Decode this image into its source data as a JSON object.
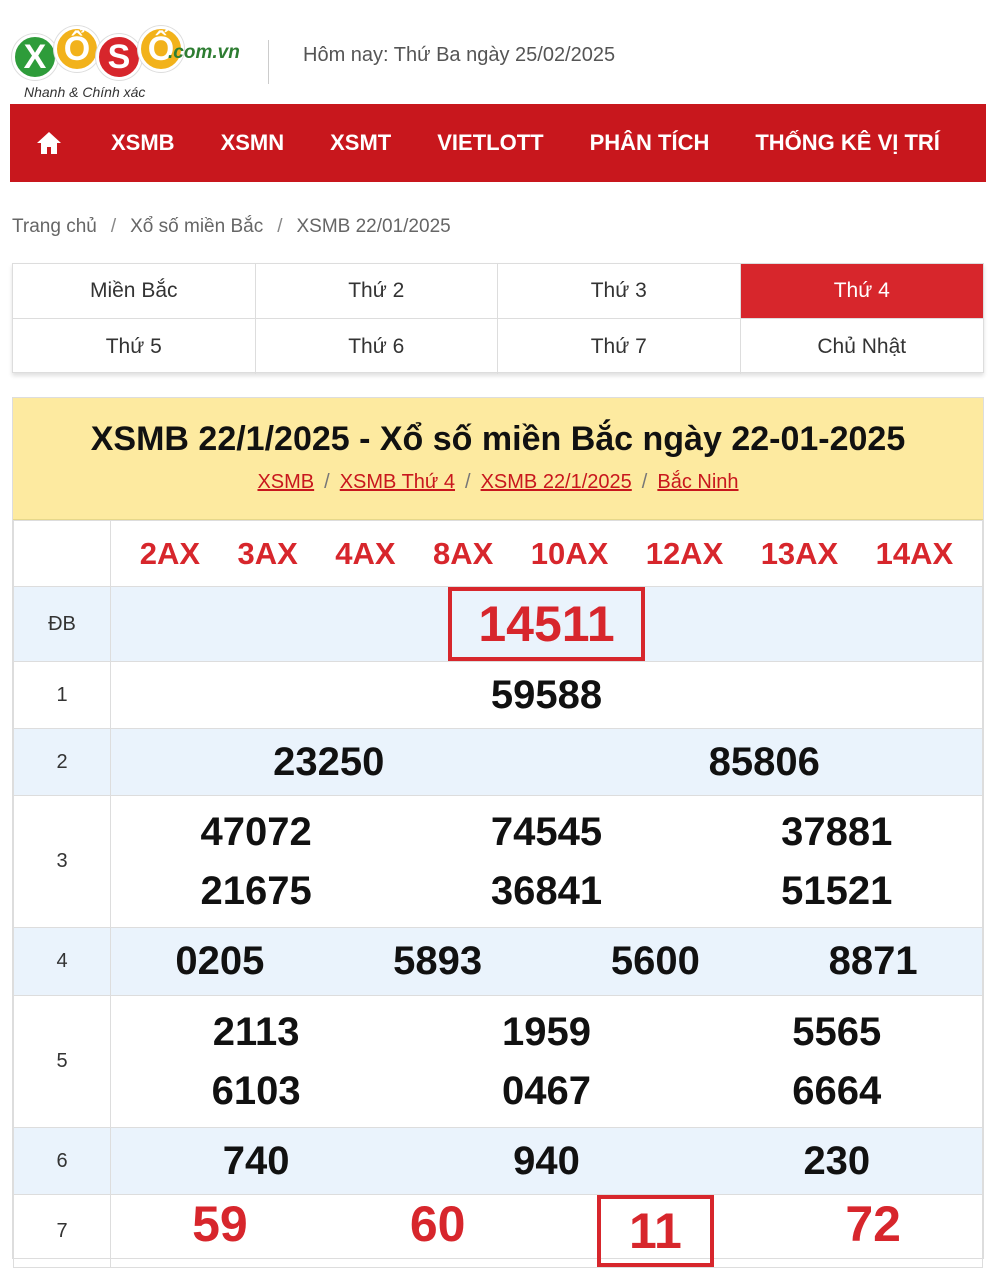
{
  "header": {
    "logo_letters": [
      "X",
      "Ổ",
      "S",
      "Ố"
    ],
    "logo_domain": ".com.vn",
    "logo_slogan": "Nhanh & Chính xác",
    "today": "Hôm nay: Thứ Ba ngày 25/02/2025"
  },
  "nav": {
    "home_icon": "home-icon",
    "items": [
      "XSMB",
      "XSMN",
      "XSMT",
      "VIETLOTT",
      "PHÂN TÍCH",
      "THỐNG KÊ VỊ TRÍ"
    ]
  },
  "breadcrumb": [
    "Trang chủ",
    "Xổ số miền Bắc",
    "XSMB 22/01/2025"
  ],
  "day_tabs": [
    "Miền Bắc",
    "Thứ 2",
    "Thứ 3",
    "Thứ 4",
    "Thứ 5",
    "Thứ 6",
    "Thứ 7",
    "Chủ Nhật"
  ],
  "active_tab": "Thứ 4",
  "result": {
    "title": "XSMB 22/1/2025 - Xổ số miền Bắc ngày 22-01-2025",
    "links": [
      "XSMB",
      "XSMB Thứ 4",
      "XSMB 22/1/2025",
      "Bắc Ninh"
    ],
    "codes": [
      "2AX",
      "3AX",
      "4AX",
      "8AX",
      "10AX",
      "12AX",
      "13AX",
      "14AX"
    ],
    "prizes": {
      "db_label": "ĐB",
      "db": "14511",
      "g1_label": "1",
      "g1": "59588",
      "g2_label": "2",
      "g2": [
        "23250",
        "85806"
      ],
      "g3_label": "3",
      "g3": [
        "47072",
        "74545",
        "37881",
        "21675",
        "36841",
        "51521"
      ],
      "g4_label": "4",
      "g4": [
        "0205",
        "5893",
        "5600",
        "8871"
      ],
      "g5_label": "5",
      "g5": [
        "2113",
        "1959",
        "5565",
        "6103",
        "0467",
        "6664"
      ],
      "g6_label": "6",
      "g6": [
        "740",
        "940",
        "230"
      ],
      "g7_label": "7",
      "g7": [
        "59",
        "60",
        "11",
        "72"
      ]
    },
    "colors": {
      "accent": "#d7262c",
      "nav": "#c8171d",
      "head_bg": "#fdeaa0",
      "row_alt": "#eaf3fc"
    }
  }
}
